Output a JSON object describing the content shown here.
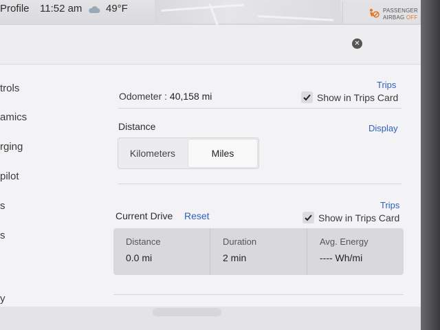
{
  "status_bar": {
    "profile": "Profile",
    "time": "11:52 am",
    "temperature": "49°F",
    "airbag_line1": "PASSENGER",
    "airbag_line2_prefix": "AIRBAG ",
    "airbag_line2_state": "OFF"
  },
  "sidebar": {
    "items": [
      {
        "label": "trols"
      },
      {
        "label": "amics"
      },
      {
        "label": "rging"
      },
      {
        "label": "pilot"
      },
      {
        "label": "s"
      },
      {
        "label": "s"
      },
      {
        "label": "y"
      }
    ]
  },
  "odometer": {
    "label": "Odometer",
    "separator": ":",
    "value": "40,158 mi",
    "section_link": "Trips",
    "show_in_trips_label": "Show in Trips Card",
    "show_in_trips_checked": true
  },
  "distance": {
    "label": "Distance",
    "section_link": "Display",
    "options": [
      "Kilometers",
      "Miles"
    ],
    "selected": "Miles"
  },
  "current_drive": {
    "label": "Current Drive",
    "reset_label": "Reset",
    "section_link": "Trips",
    "show_in_trips_label": "Show in Trips Card",
    "show_in_trips_checked": true,
    "stats": [
      {
        "header": "Distance",
        "value": "0.0 mi"
      },
      {
        "header": "Duration",
        "value": "2 min"
      },
      {
        "header": "Avg. Energy",
        "value": "---- Wh/mi"
      }
    ]
  },
  "icons": {
    "weather": "cloud-icon",
    "close": "close-icon",
    "airbag": "airbag-icon",
    "check": "checkmark-icon"
  },
  "colors": {
    "link": "#2f5fbf",
    "airbag_off": "#e07a2a"
  }
}
